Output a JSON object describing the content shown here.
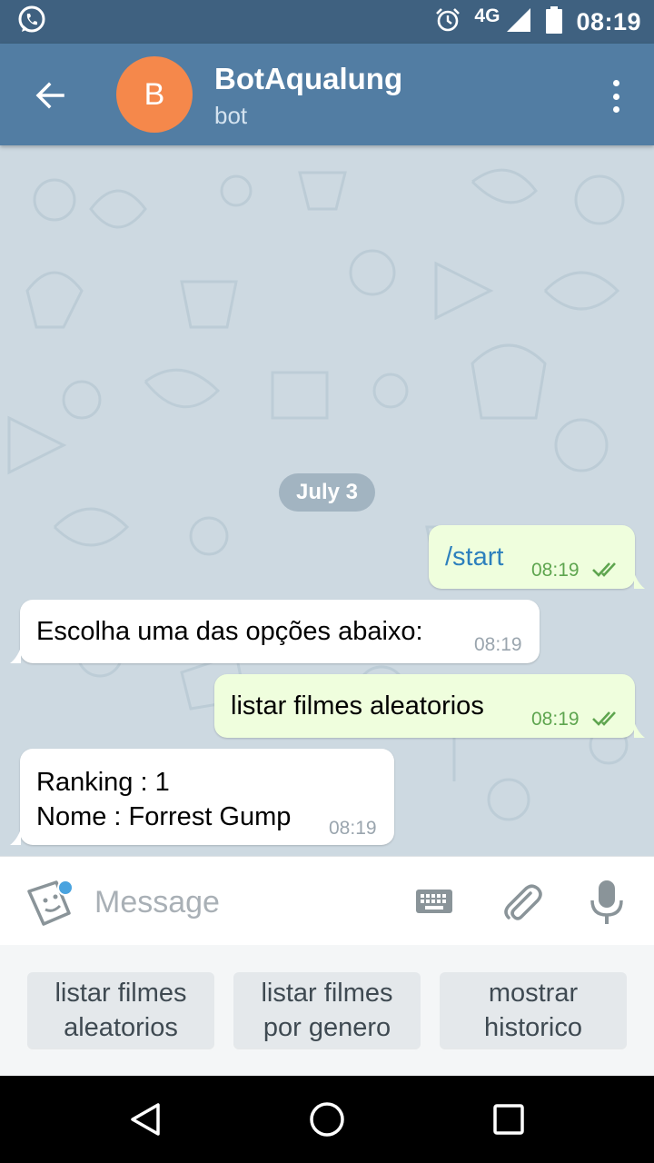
{
  "status_bar": {
    "time": "08:19",
    "network": "4G",
    "icons": [
      "whatsapp-icon",
      "alarm-icon",
      "signal-icon",
      "battery-icon"
    ]
  },
  "header": {
    "avatar_letter": "B",
    "avatar_color": "#f5884b",
    "title": "BotAqualung",
    "subtitle": "bot"
  },
  "chat": {
    "date_separator": "July 3",
    "messages": [
      {
        "direction": "out",
        "text": "/start",
        "time": "08:19",
        "read": true
      },
      {
        "direction": "in",
        "text": "Escolha uma das opções abaixo:",
        "time": "08:19"
      },
      {
        "direction": "out",
        "text": "listar filmes aleatorios",
        "time": "08:19",
        "read": true
      },
      {
        "direction": "in",
        "text": "Ranking : 1\nNome : Forrest Gump",
        "time": "08:19"
      }
    ]
  },
  "input": {
    "placeholder": "Message"
  },
  "bot_keyboard": {
    "buttons": [
      "listar filmes\naleatorios",
      "listar filmes\npor genero",
      "mostrar\nhistorico"
    ]
  },
  "colors": {
    "status_bar": "#3f6180",
    "header": "#527da3",
    "outgoing_bubble": "#effedd",
    "incoming_bubble": "#ffffff",
    "time_outgoing": "#5ea54f",
    "command_link": "#2d80bd"
  }
}
